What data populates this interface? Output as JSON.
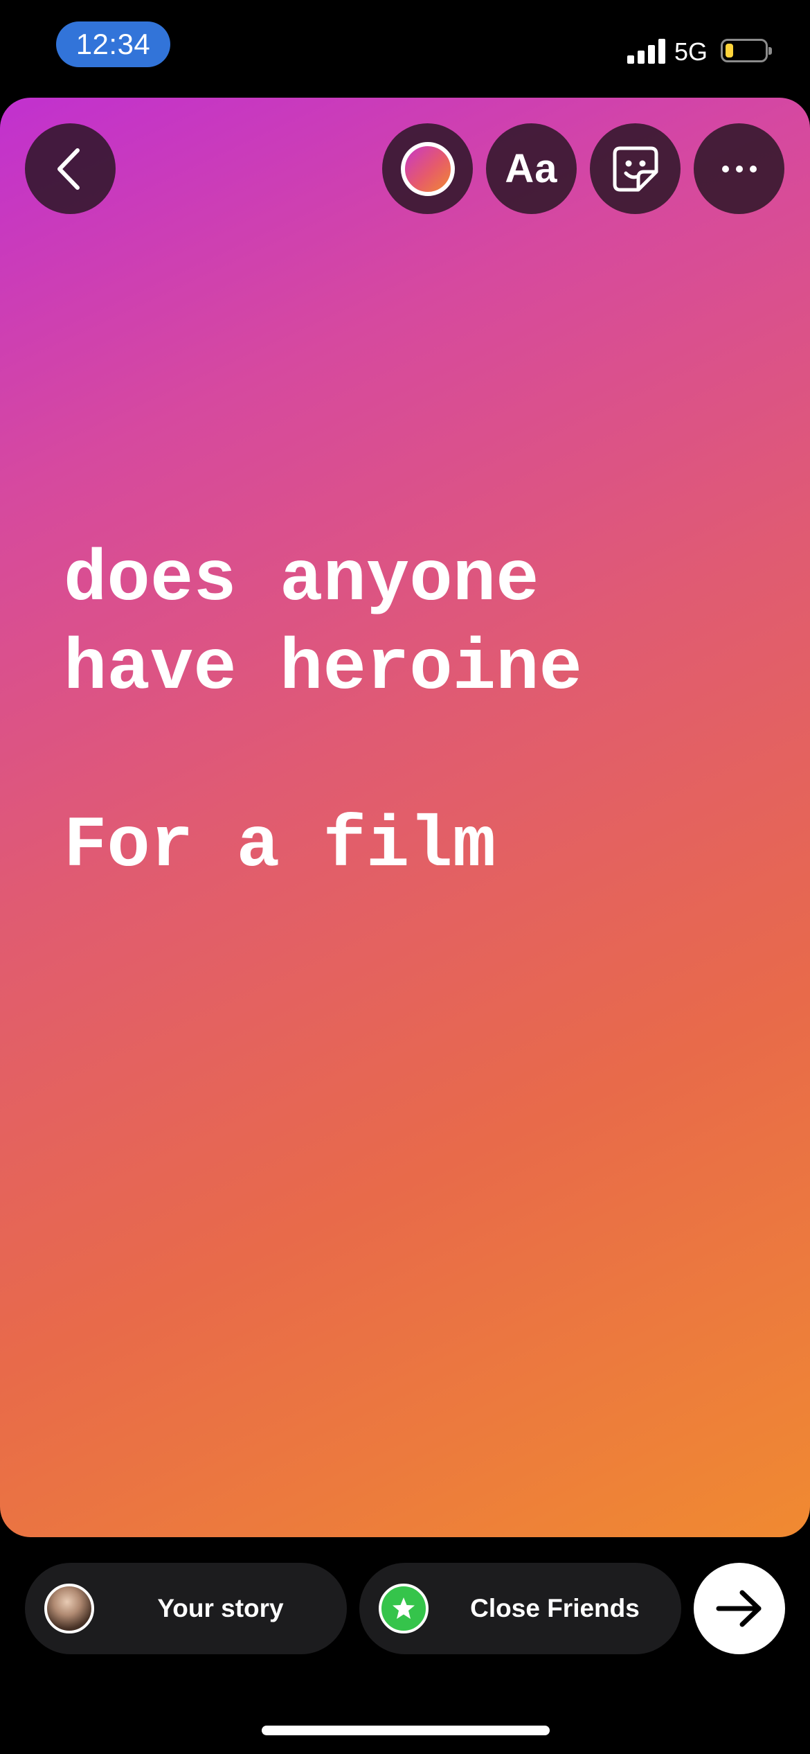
{
  "status_bar": {
    "time": "12:34",
    "network": "5G",
    "battery_level": 0.2
  },
  "top_toolbar": {
    "text_tool_label": "Aa",
    "icons": [
      "back-icon",
      "color-swatch-icon",
      "text-icon",
      "sticker-icon",
      "more-icon"
    ]
  },
  "story": {
    "text": "does anyone\nhave heroine\n\nFor a film",
    "background_colors": [
      "#c131cf",
      "#d6499f",
      "#e05b72",
      "#e86a4a",
      "#f08a31"
    ]
  },
  "share_bar": {
    "your_story_label": "Your story",
    "close_friends_label": "Close Friends",
    "close_friends_color": "#35c44b"
  }
}
